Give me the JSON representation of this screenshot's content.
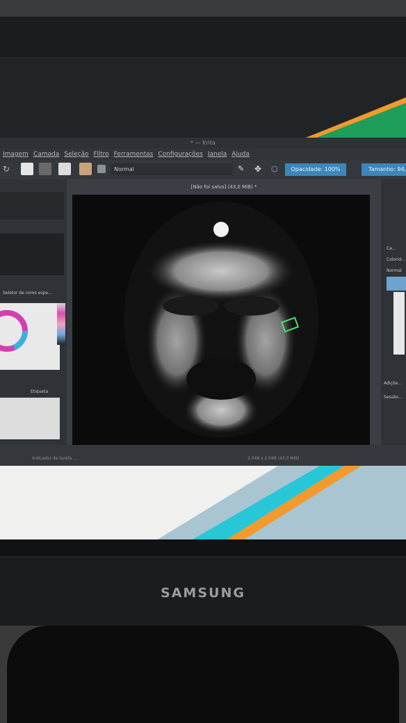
{
  "window": {
    "title": "* — Krita",
    "doc_title": "[Não foi salvo]  (43,0 MiB) *"
  },
  "menu": [
    "Imagem",
    "Camada",
    "Seleção",
    "Filtro",
    "Ferramentas",
    "Configurações",
    "Janela",
    "Ajuda"
  ],
  "toolbar": {
    "blend_mode": "Normal",
    "opacity_label": "Opacidade: 100%",
    "size_label": "Tamanho: 94,"
  },
  "left_panel": {
    "color_selector_title": "Seletor de cores espe...",
    "brush_tag": "Etiqueta"
  },
  "right_panel": {
    "blend": "Normal",
    "labels": [
      "Ca...",
      "Colorid...",
      "Adiçõe...",
      "Sessão..."
    ]
  },
  "status": {
    "left": "Indicador de tarefa ... ",
    "right": "2.048 x 2.048 (43,0 MiB)"
  },
  "monitor": {
    "brand": "SAMSUNG"
  },
  "colors": {
    "accent": "#3d86b8",
    "wallpaper_orange": "#f29a2e",
    "wallpaper_green": "#1e9e5a",
    "wallpaper_cyan": "#28c7d8"
  }
}
